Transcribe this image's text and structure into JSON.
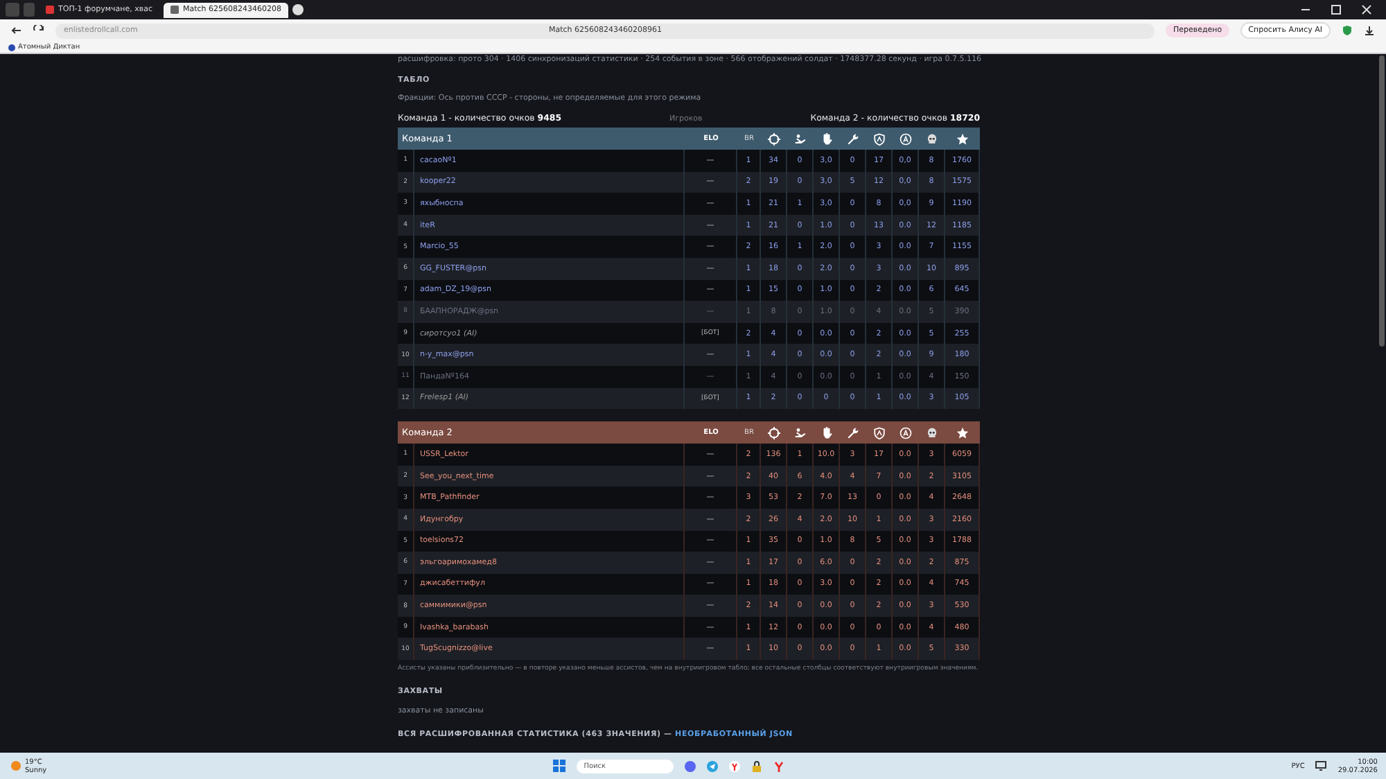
{
  "browser": {
    "tabs": [
      {
        "label": "ТОП-1 форумчане, хвас",
        "selected": false
      },
      {
        "label": "Match 625608243460208",
        "selected": true
      }
    ],
    "address": "enlistedrollcall.com",
    "page_title": "Match 625608243460208961",
    "translated_button": "Переведено",
    "ask_button": "Спросить Алису AI",
    "bookmark": "Атомный Диктан"
  },
  "page": {
    "intro": "расшифровка: прото 304 · 1406 синхронизаций статистики · 254 события в зоне · 566 отображений солдат · 1748377.28 секунд · игра 0.7.5.116",
    "scoreboard_heading": "ТАБЛО",
    "factions": "Фракции: Ось против СССР - стороны, не определяемые для этого режима",
    "team1_score_label": "Команда 1 - количество очков",
    "team1_score": "9485",
    "players_label": "Игроков",
    "team2_score_label": "Команда 2 - количество очков",
    "team2_score": "18720",
    "teams": [
      {
        "name": "Команда 1",
        "color": "#3e5b6e",
        "elo_header": "ELO",
        "br_header": "BR",
        "players": [
          {
            "num": "1",
            "name": "cacaoNº1",
            "kind": "human",
            "greyed": false,
            "elo": "—",
            "stats": [
              "1",
              "34",
              "0",
              "3,0",
              "0",
              "17",
              "0,0",
              "8",
              "1760"
            ]
          },
          {
            "num": "2",
            "name": "kooper22",
            "kind": "human",
            "greyed": false,
            "elo": "—",
            "stats": [
              "2",
              "19",
              "0",
              "3,0",
              "5",
              "12",
              "0,0",
              "8",
              "1575"
            ]
          },
          {
            "num": "3",
            "name": "яхыбноспа",
            "kind": "human",
            "greyed": false,
            "elo": "—",
            "stats": [
              "1",
              "21",
              "1",
              "3,0",
              "0",
              "8",
              "0,0",
              "9",
              "1190"
            ]
          },
          {
            "num": "4",
            "name": "iteR",
            "kind": "human",
            "greyed": false,
            "elo": "—",
            "stats": [
              "1",
              "21",
              "0",
              "1.0",
              "0",
              "13",
              "0.0",
              "12",
              "1185"
            ]
          },
          {
            "num": "5",
            "name": "Marcio_55",
            "kind": "human",
            "greyed": false,
            "elo": "—",
            "stats": [
              "2",
              "16",
              "1",
              "2.0",
              "0",
              "3",
              "0.0",
              "7",
              "1155"
            ]
          },
          {
            "num": "6",
            "name": "GG_FUSTER@psn",
            "kind": "human",
            "greyed": false,
            "elo": "—",
            "stats": [
              "1",
              "18",
              "0",
              "2.0",
              "0",
              "3",
              "0.0",
              "10",
              "895"
            ]
          },
          {
            "num": "7",
            "name": "adam_DZ_19@psn",
            "kind": "human",
            "greyed": false,
            "elo": "—",
            "stats": [
              "1",
              "15",
              "0",
              "1.0",
              "0",
              "2",
              "0.0",
              "6",
              "645"
            ]
          },
          {
            "num": "8",
            "name": "БААПНОРАДЖ@psn",
            "kind": "human",
            "greyed": true,
            "elo": "—",
            "stats": [
              "1",
              "8",
              "0",
              "1.0",
              "0",
              "4",
              "0.0",
              "5",
              "390"
            ]
          },
          {
            "num": "9",
            "name": "сиротсуо1 (AI)",
            "kind": "bot",
            "greyed": false,
            "elo": "[БОТ]",
            "stats": [
              "2",
              "4",
              "0",
              "0.0",
              "0",
              "2",
              "0.0",
              "5",
              "255"
            ]
          },
          {
            "num": "10",
            "name": "n-y_max@psn",
            "kind": "human",
            "greyed": false,
            "elo": "—",
            "stats": [
              "1",
              "4",
              "0",
              "0.0",
              "0",
              "2",
              "0.0",
              "9",
              "180"
            ]
          },
          {
            "num": "11",
            "name": "ПандаNº164",
            "kind": "human",
            "greyed": true,
            "elo": "—",
            "stats": [
              "1",
              "4",
              "0",
              "0.0",
              "0",
              "1",
              "0.0",
              "4",
              "150"
            ]
          },
          {
            "num": "12",
            "name": "Frelesp1 (AI)",
            "kind": "bot",
            "greyed": false,
            "elo": "[БОТ]",
            "stats": [
              "1",
              "2",
              "0",
              "0",
              "0",
              "1",
              "0.0",
              "3",
              "105"
            ]
          }
        ]
      },
      {
        "name": "Команда 2",
        "color": "#7b4a40",
        "elo_header": "ELO",
        "br_header": "BR",
        "players": [
          {
            "num": "1",
            "name": "USSR_Lektor",
            "kind": "human",
            "greyed": false,
            "elo": "—",
            "stats": [
              "2",
              "136",
              "1",
              "10.0",
              "3",
              "17",
              "0.0",
              "3",
              "6059"
            ]
          },
          {
            "num": "2",
            "name": "See_you_next_time",
            "kind": "human",
            "greyed": false,
            "elo": "—",
            "stats": [
              "2",
              "40",
              "6",
              "4.0",
              "4",
              "7",
              "0.0",
              "2",
              "3105"
            ]
          },
          {
            "num": "3",
            "name": "MTB_Pathfinder",
            "kind": "human",
            "greyed": false,
            "elo": "—",
            "stats": [
              "3",
              "53",
              "2",
              "7.0",
              "13",
              "0",
              "0.0",
              "4",
              "2648"
            ]
          },
          {
            "num": "4",
            "name": "Идунгобру",
            "kind": "human",
            "greyed": false,
            "elo": "—",
            "stats": [
              "2",
              "26",
              "4",
              "2.0",
              "10",
              "1",
              "0.0",
              "3",
              "2160"
            ]
          },
          {
            "num": "5",
            "name": "toelsions72",
            "kind": "human",
            "greyed": false,
            "elo": "—",
            "stats": [
              "1",
              "35",
              "0",
              "1.0",
              "8",
              "5",
              "0.0",
              "3",
              "1788"
            ]
          },
          {
            "num": "6",
            "name": "эльгоаримохамед8",
            "kind": "human",
            "greyed": false,
            "elo": "—",
            "stats": [
              "1",
              "17",
              "0",
              "6.0",
              "0",
              "2",
              "0.0",
              "2",
              "875"
            ]
          },
          {
            "num": "7",
            "name": "джисабеттифул",
            "kind": "human",
            "greyed": false,
            "elo": "—",
            "stats": [
              "1",
              "18",
              "0",
              "3.0",
              "0",
              "2",
              "0.0",
              "4",
              "745"
            ]
          },
          {
            "num": "8",
            "name": "саммимики@psn",
            "kind": "human",
            "greyed": false,
            "elo": "—",
            "stats": [
              "2",
              "14",
              "0",
              "0.0",
              "0",
              "2",
              "0.0",
              "3",
              "530"
            ]
          },
          {
            "num": "9",
            "name": "Ivashka_barabash",
            "kind": "human",
            "greyed": false,
            "elo": "—",
            "stats": [
              "1",
              "12",
              "0",
              "0.0",
              "0",
              "0",
              "0.0",
              "4",
              "480"
            ]
          },
          {
            "num": "10",
            "name": "TugScugnizzo@live",
            "kind": "human",
            "greyed": false,
            "elo": "—",
            "stats": [
              "1",
              "10",
              "0",
              "0.0",
              "0",
              "1",
              "0.0",
              "5",
              "330"
            ]
          }
        ]
      }
    ],
    "assists_note": "Ассисты указаны приблизительно — в повторе указано меньше ассистов, чем на внутриигровом табло; все остальные столбцы соответствуют внутриигровым значениям.",
    "captures_heading": "ЗАХВАТЫ",
    "captures_text": "захваты не записаны",
    "all_stats_heading": "ВСЯ РАСШИФРОВАННАЯ СТАТИСТИКА (463 ЗНАЧЕНИЯ) —",
    "raw_json_link": "НЕОБРАБОТАННЫЙ JSON"
  },
  "taskbar": {
    "temperature": "19°C",
    "weather": "Sunny",
    "search_placeholder": "Поиск",
    "language": "РУС",
    "time": "10:00",
    "date": "29.07.2026"
  }
}
